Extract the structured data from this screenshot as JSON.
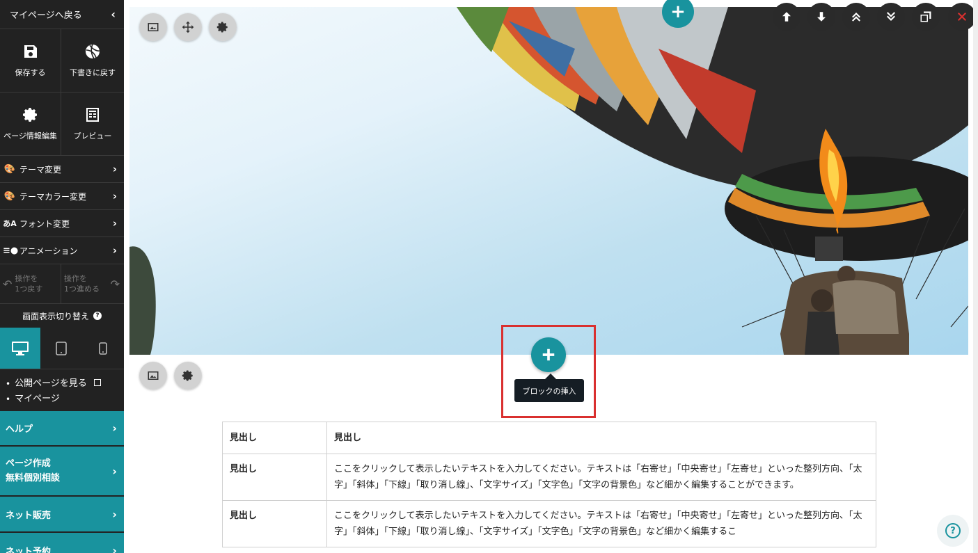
{
  "sidebar": {
    "back_label": "マイページへ戻る",
    "save_label": "保存する",
    "draft_label": "下書きに戻す",
    "page_info_label": "ページ情報編集",
    "preview_label": "プレビュー",
    "menu": [
      {
        "label": "テーマ変更",
        "icon": "palette-icon"
      },
      {
        "label": "テーマカラー変更",
        "icon": "color-palette-icon"
      },
      {
        "label": "フォント変更",
        "icon": "font-icon"
      },
      {
        "label": "アニメーション",
        "icon": "animation-icon"
      }
    ],
    "undo_label_1": "操作を",
    "undo_label_2": "1つ戻す",
    "redo_label_1": "操作を",
    "redo_label_2": "1つ進める",
    "view_switch_title": "画面表示切り替え",
    "view_modes": [
      "desktop",
      "tablet",
      "mobile"
    ],
    "links": [
      "公開ページを見る",
      "マイページ"
    ],
    "teal_items": [
      {
        "label": "ヘルプ"
      },
      {
        "label_1": "ページ作成",
        "label_2": "無料個別相談"
      },
      {
        "label": "ネット販売"
      },
      {
        "label": "ネット予約"
      }
    ],
    "accent_color": "#19939e"
  },
  "insert_tooltip": "ブロックの挿入",
  "table": {
    "header": [
      "見出し",
      "見出し"
    ],
    "rows": [
      [
        "見出し",
        "ここをクリックして表示したいテキストを入力してください。テキストは「右寄せ」「中央寄せ」「左寄せ」といった整列方向、「太字」「斜体」「下線」「取り消し線」、「文字サイズ」「文字色」「文字の背景色」など細かく編集することができます。"
      ],
      [
        "見出し",
        "ここをクリックして表示したいテキストを入力してください。テキストは「右寄せ」「中央寄せ」「左寄せ」といった整列方向、「太字」「斜体」「下線」「取り消し線」、「文字サイズ」「文字色」「文字の背景色」など細かく編集するこ"
      ]
    ]
  },
  "help_fab": "?"
}
